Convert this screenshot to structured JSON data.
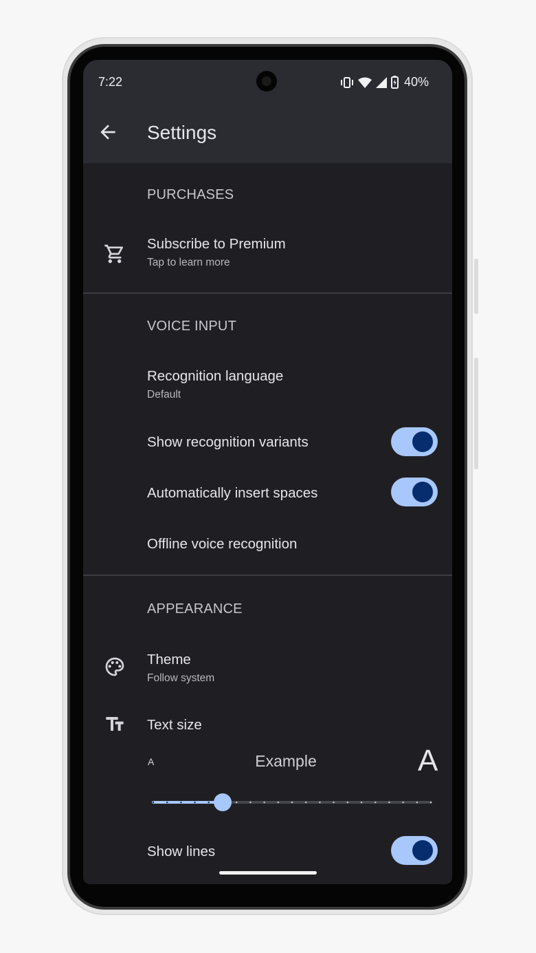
{
  "status_bar": {
    "time": "7:22",
    "battery": "40%"
  },
  "app_bar": {
    "title": "Settings"
  },
  "purchases": {
    "header": "PURCHASES",
    "premium": {
      "title": "Subscribe to Premium",
      "subtitle": "Tap to learn more",
      "icon": "cart-icon"
    }
  },
  "voice_input": {
    "header": "VOICE INPUT",
    "recognition_language": {
      "title": "Recognition language",
      "subtitle": "Default"
    },
    "show_variants": {
      "title": "Show recognition variants",
      "enabled": true
    },
    "insert_spaces": {
      "title": "Automatically insert spaces",
      "enabled": true
    },
    "offline": {
      "title": "Offline voice recognition"
    }
  },
  "appearance": {
    "header": "APPEARANCE",
    "theme": {
      "title": "Theme",
      "subtitle": "Follow system",
      "icon": "palette-icon"
    },
    "text_size": {
      "title": "Text size",
      "icon": "text-size-icon",
      "small_label": "A",
      "example": "Example",
      "large_label": "A",
      "steps": 20,
      "current_step": 5
    },
    "show_lines": {
      "title": "Show lines",
      "enabled": true
    }
  },
  "colors": {
    "background": "#1f1f23",
    "toolbar": "#2a2c31",
    "toggle_track": "#a8c7fa",
    "toggle_thumb": "#062e6f",
    "slider_active": "#a8c7fa",
    "divider": "#3b3c41"
  }
}
